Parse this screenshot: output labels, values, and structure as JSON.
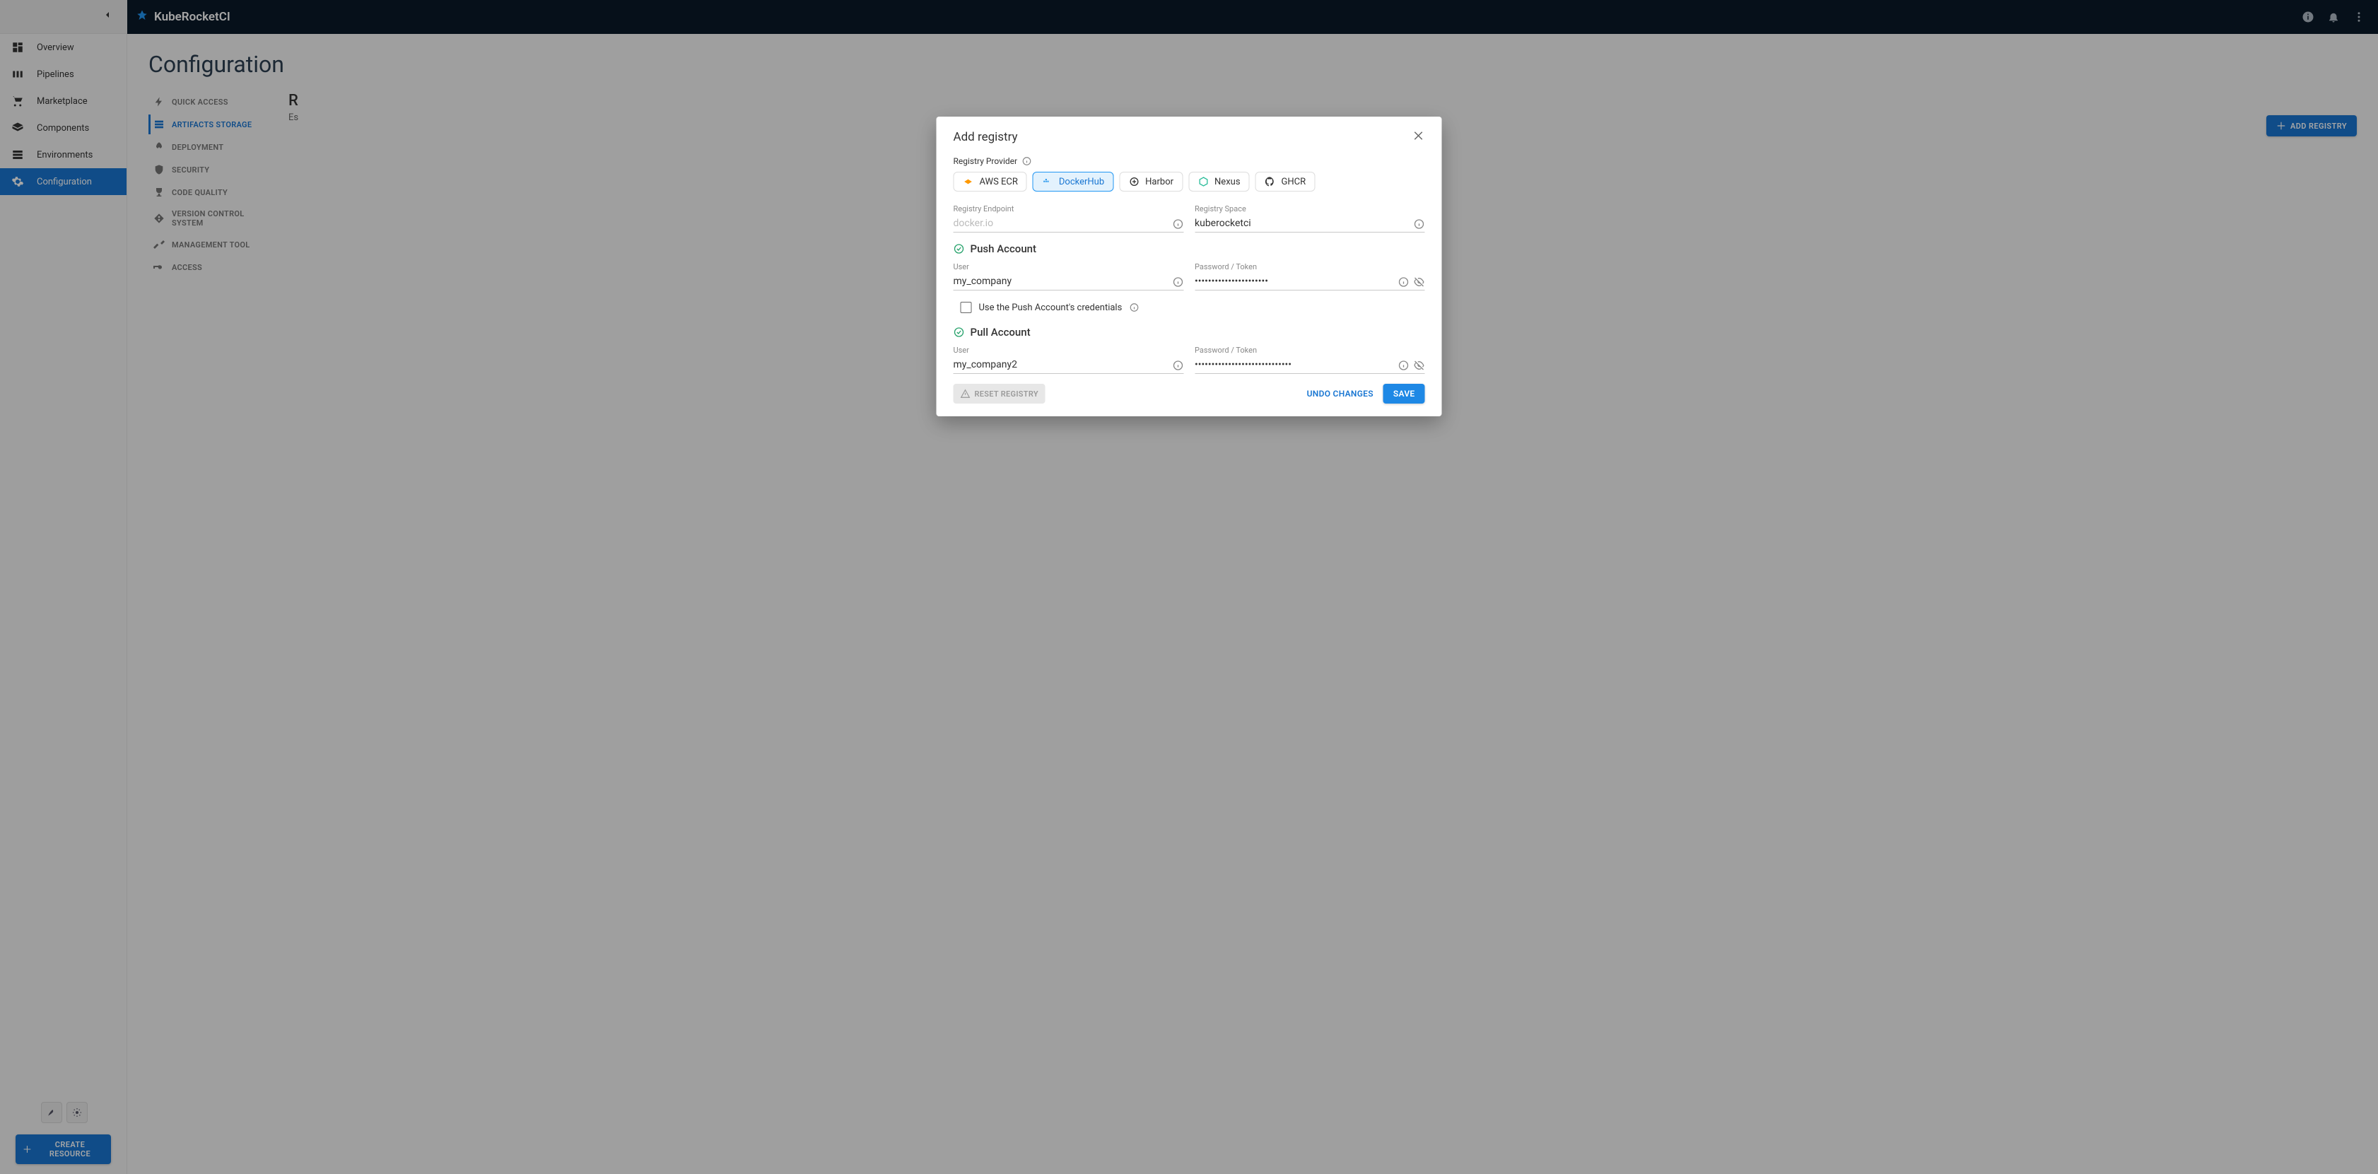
{
  "brand": "KubeRocketCI",
  "sidebar": {
    "items": [
      {
        "label": "Overview"
      },
      {
        "label": "Pipelines"
      },
      {
        "label": "Marketplace"
      },
      {
        "label": "Components"
      },
      {
        "label": "Environments"
      },
      {
        "label": "Configuration"
      }
    ],
    "create_button": "CREATE RESOURCE"
  },
  "page": {
    "title": "Configuration",
    "section_heading": "R",
    "section_sub": "Es"
  },
  "sub_nav": [
    {
      "label": "QUICK ACCESS"
    },
    {
      "label": "ARTIFACTS STORAGE"
    },
    {
      "label": "DEPLOYMENT"
    },
    {
      "label": "SECURITY"
    },
    {
      "label": "CODE QUALITY"
    },
    {
      "label": "VERSION CONTROL SYSTEM"
    },
    {
      "label": "MANAGEMENT TOOL"
    },
    {
      "label": "ACCESS"
    }
  ],
  "toolbar": {
    "add_registry": "ADD REGISTRY"
  },
  "dialog": {
    "title": "Add registry",
    "provider_label": "Registry Provider",
    "providers": [
      {
        "name": "AWS ECR"
      },
      {
        "name": "DockerHub"
      },
      {
        "name": "Harbor"
      },
      {
        "name": "Nexus"
      },
      {
        "name": "GHCR"
      }
    ],
    "selected_provider_index": 1,
    "endpoint": {
      "label": "Registry Endpoint",
      "placeholder": "docker.io",
      "value": ""
    },
    "space": {
      "label": "Registry Space",
      "value": "kuberocketci"
    },
    "push_section": "Push Account",
    "push_user": {
      "label": "User",
      "value": "my_company"
    },
    "push_password": {
      "label": "Password / Token",
      "value": "••••••••••••••••••••••"
    },
    "use_push_checkbox": "Use the Push Account's credentials",
    "use_push_checked": false,
    "pull_section": "Pull Account",
    "pull_user": {
      "label": "User",
      "value": "my_company2"
    },
    "pull_password": {
      "label": "Password / Token",
      "value": "•••••••••••••••••••••••••••••"
    },
    "reset": "RESET REGISTRY",
    "undo": "UNDO CHANGES",
    "save": "SAVE"
  }
}
